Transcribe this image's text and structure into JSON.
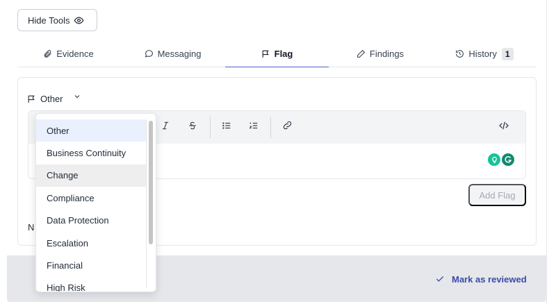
{
  "toolbar": {
    "hide_tools_label": "Hide Tools"
  },
  "tabs": [
    {
      "label": "Evidence",
      "icon": "paperclip-icon"
    },
    {
      "label": "Messaging",
      "icon": "chat-bubble-icon"
    },
    {
      "label": "Flag",
      "icon": "flag-icon",
      "active": true
    },
    {
      "label": "Findings",
      "icon": "pencil-icon"
    },
    {
      "label": "History",
      "icon": "history-icon",
      "badge": "1"
    }
  ],
  "flag": {
    "selected_type": "Other",
    "add_flag_label": "Add Flag",
    "notes_peek": "N"
  },
  "editor_toolbar": [
    "italic",
    "strikethrough",
    "bullet-list",
    "numbered-list",
    "link",
    "code"
  ],
  "dropdown": {
    "options": [
      "Other",
      "Business Continuity",
      "Change",
      "Compliance",
      "Data Protection",
      "Escalation",
      "Financial",
      "High Risk"
    ],
    "selected": "Other",
    "hovered": "Change"
  },
  "footer": {
    "mark_reviewed_label": "Mark as reviewed"
  },
  "colors": {
    "accent": "#4f5bd5",
    "link": "#3b4aa8",
    "selected_bg": "#eaf0fd"
  }
}
